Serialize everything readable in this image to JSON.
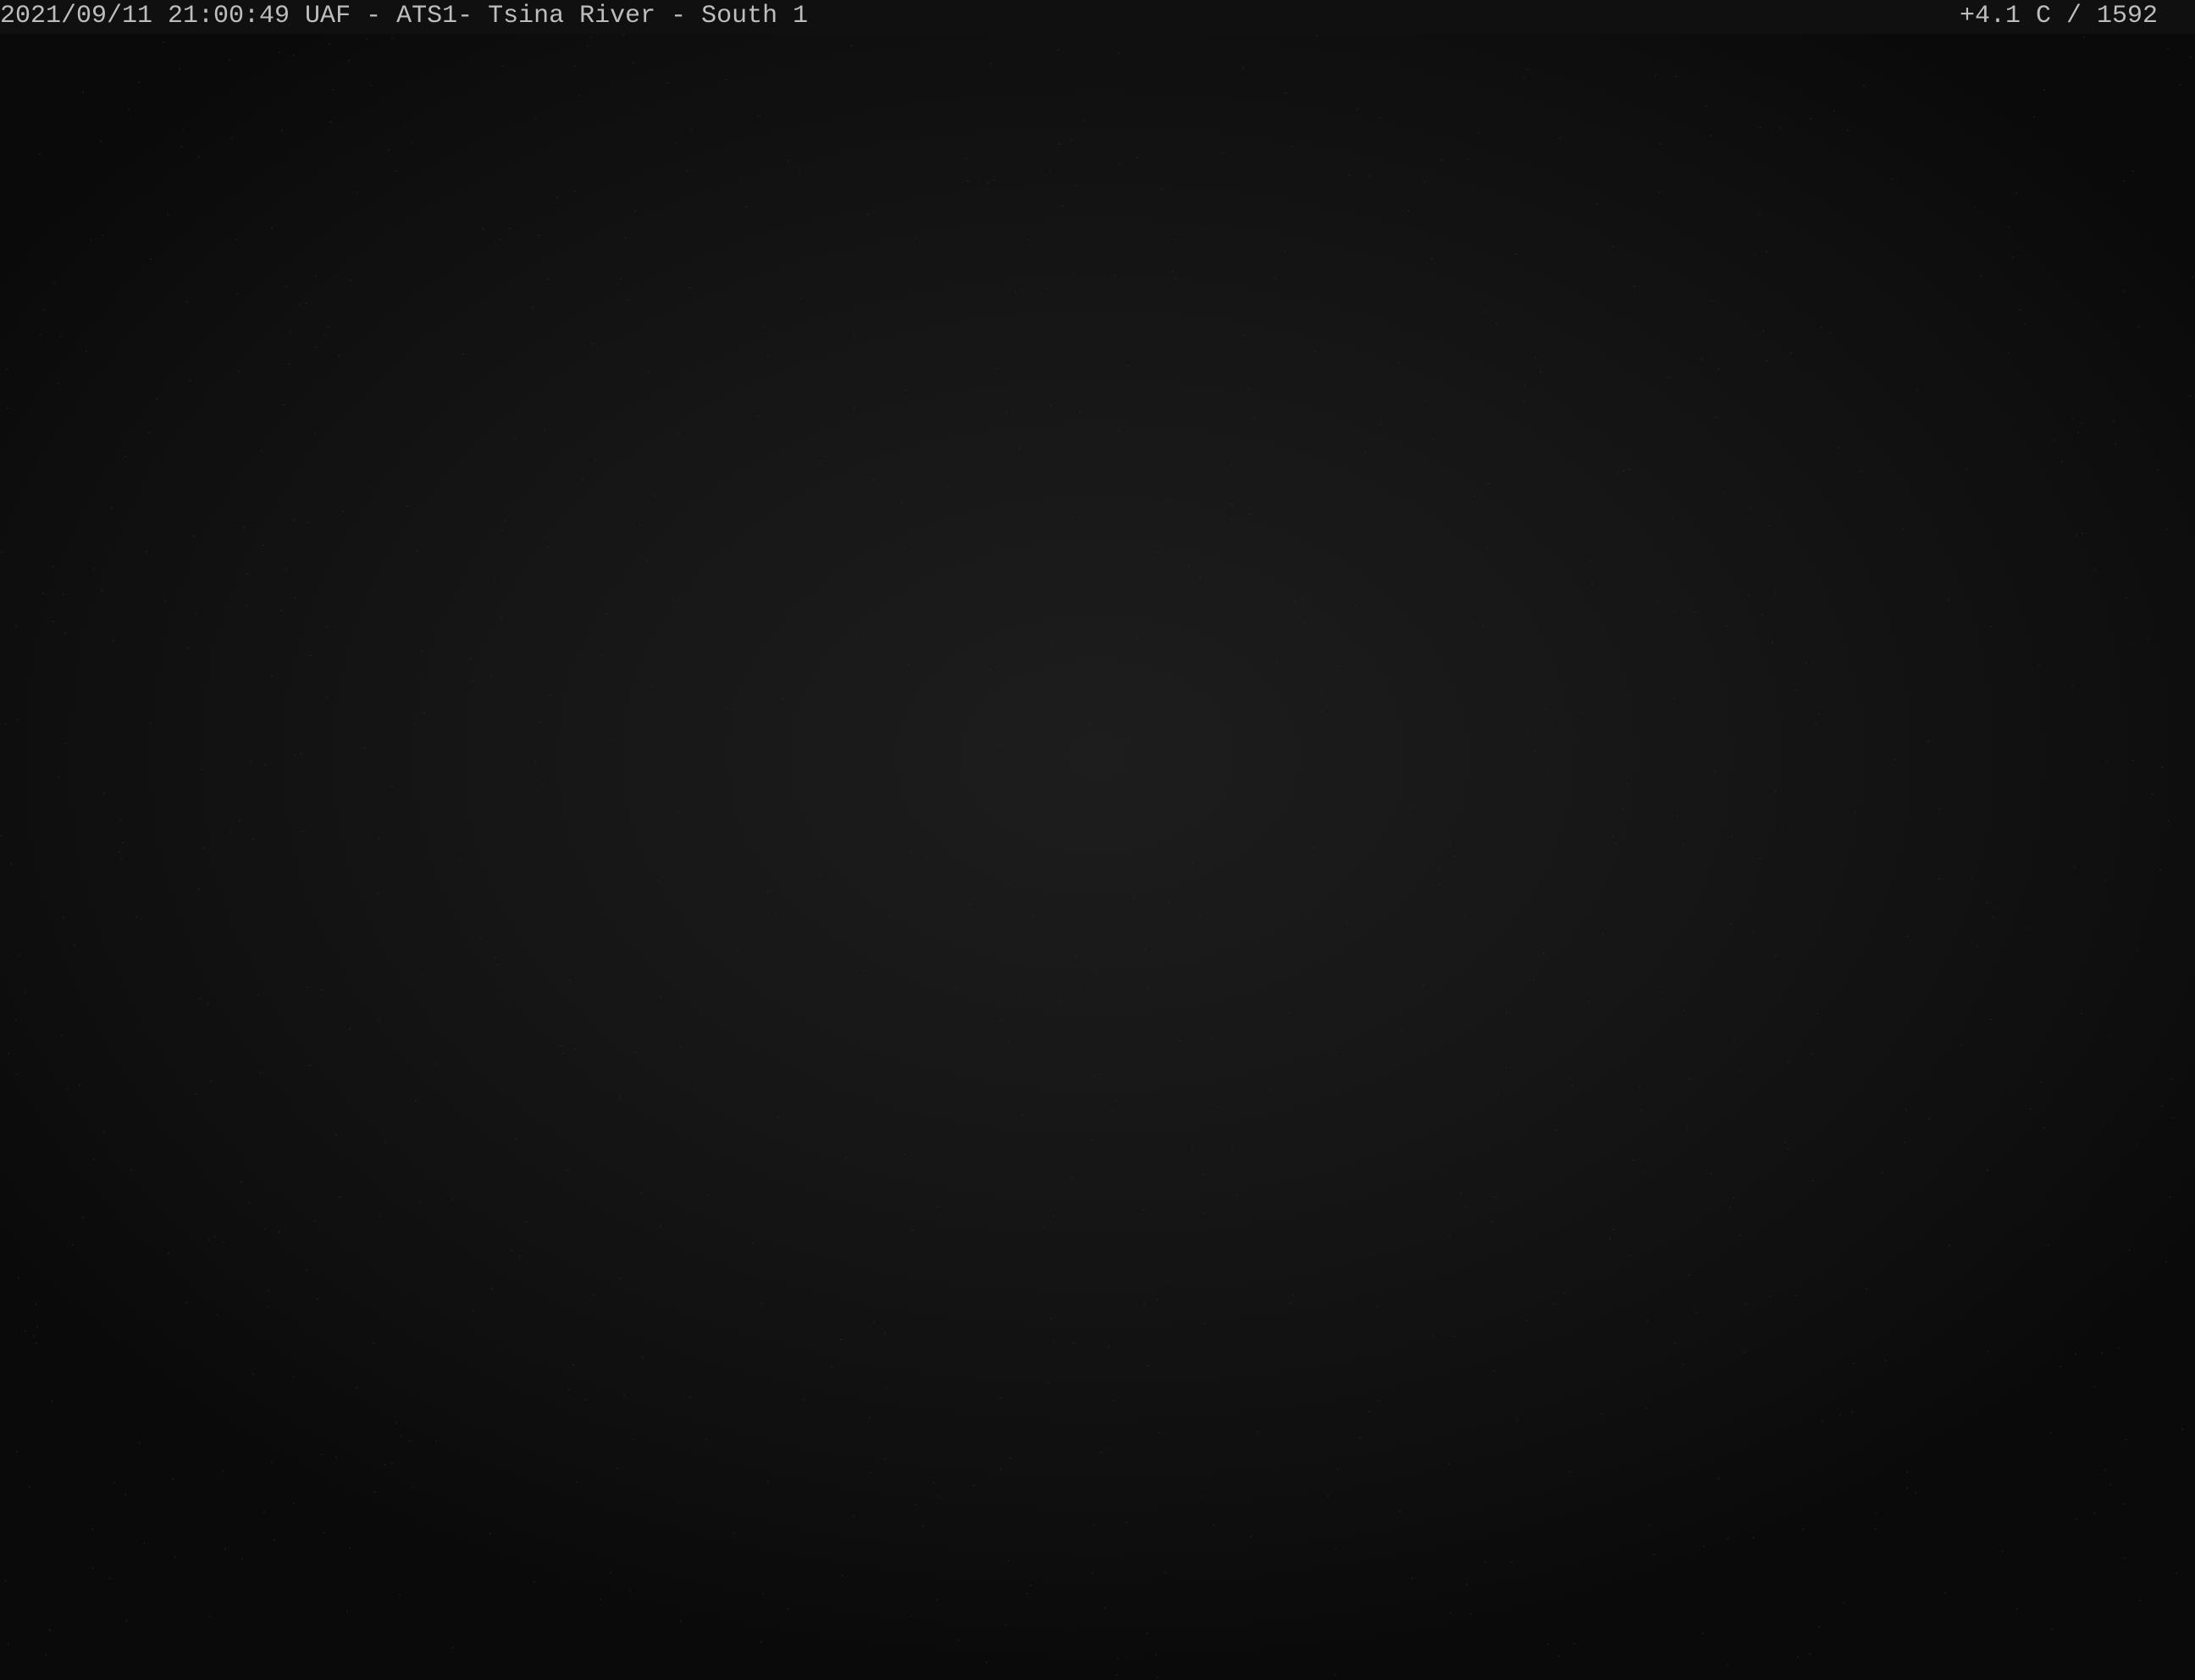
{
  "overlay": {
    "timestamp_station": "2021/09/11 21:00:49 UAF - ATS1- Tsina River - South 1",
    "temperature_reading": "+4.1 C / 1592"
  },
  "scene": {
    "background_color": "#161616",
    "text_color": "#bdbdbd"
  }
}
